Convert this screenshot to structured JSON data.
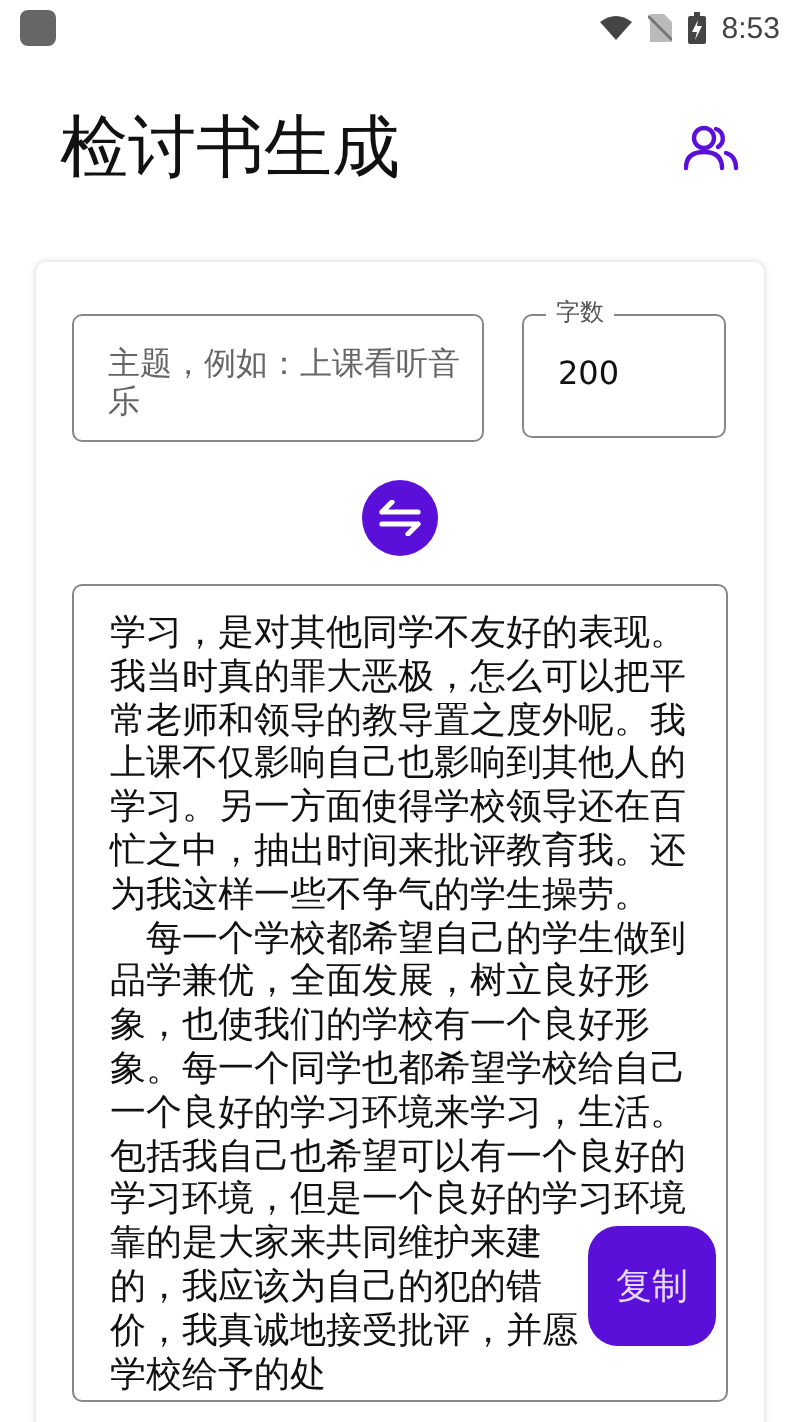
{
  "status_bar": {
    "time": "8:53"
  },
  "app_bar": {
    "title": "检讨书生成"
  },
  "form": {
    "topic": {
      "placeholder": "主题，例如：上课看听音乐"
    },
    "word_count": {
      "label": "字数",
      "value": "200"
    }
  },
  "result": {
    "lines": [
      "学习，是对其他同学不友好的表现。",
      "我当时真的罪大恶极，怎么可以把平",
      "常老师和领导的教导置之度外呢。我",
      "上课不仅影响自己也影响到其他人的",
      "学习。另一方面使得学校领导还在百",
      "忙之中，抽出时间来批评教育我。还",
      "为我这样一些不争气的学生操劳。",
      "　每一个学校都希望自己的学生做到",
      "品学兼优，全面发展，树立良好形",
      "象，也使我们的学校有一个良好形",
      "象。每一个同学也都希望学校给自己",
      "一个良好的学习环境来学习，生活。",
      "包括我自己也希望可以有一个良好的",
      "学习环境，但是一个良好的学习环境",
      "靠的是大家来共同维护来建",
      "的，我应该为自己的犯的错",
      "价，我真诚地接受批评，并愿",
      "学校给予的处"
    ]
  },
  "copy_button": {
    "label": "复制"
  }
}
